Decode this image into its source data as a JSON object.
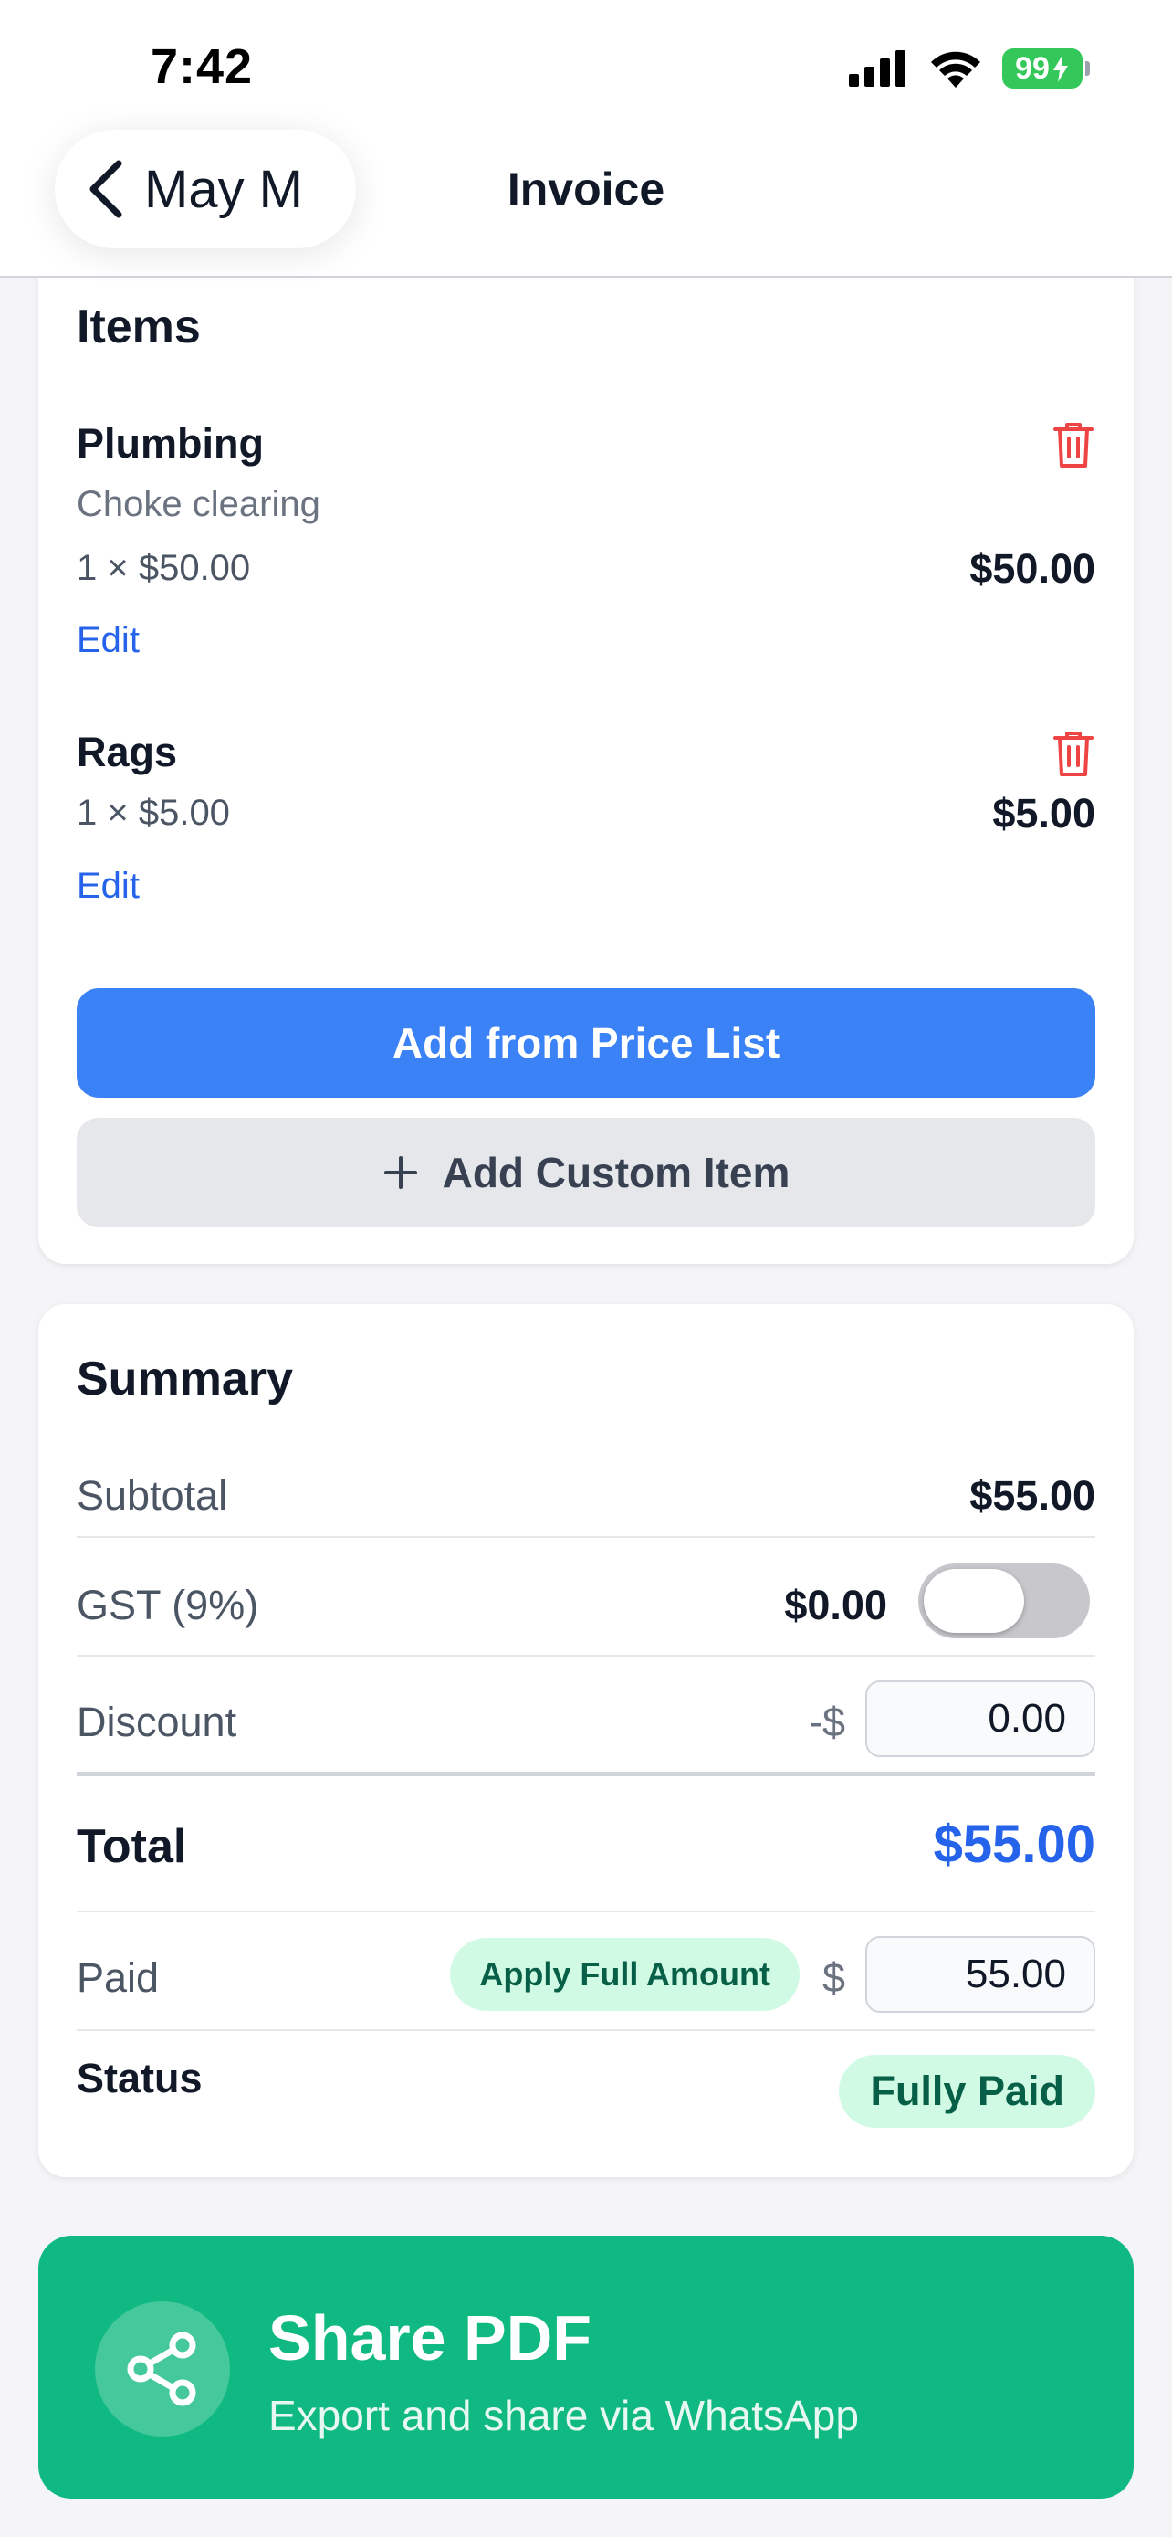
{
  "status_bar": {
    "time": "7:42",
    "battery": "99",
    "icons": [
      "cellular-signal-icon",
      "wifi-icon",
      "battery-icon",
      "charging-bolt-icon"
    ]
  },
  "nav": {
    "back_label": "May M",
    "title": "Invoice"
  },
  "items_section": {
    "heading": "Items",
    "items": [
      {
        "name": "Plumbing",
        "description": "Choke clearing",
        "qty_price": "1 × $50.00",
        "amount": "$50.00",
        "edit_label": "Edit"
      },
      {
        "name": "Rags",
        "qty_price": "1 × $5.00",
        "amount": "$5.00",
        "edit_label": "Edit"
      }
    ],
    "add_price_list_label": "Add from Price List",
    "add_custom_label": "Add Custom Item"
  },
  "summary": {
    "heading": "Summary",
    "subtotal_label": "Subtotal",
    "subtotal_value": "$55.00",
    "gst_label": "GST (9%)",
    "gst_value": "$0.00",
    "gst_enabled": false,
    "discount_label": "Discount",
    "discount_prefix": "-$",
    "discount_value": "0.00",
    "total_label": "Total",
    "total_value": "$55.00",
    "paid_label": "Paid",
    "apply_full_label": "Apply Full Amount",
    "paid_prefix": "$",
    "paid_value": "55.00",
    "status_label": "Status",
    "status_value": "Fully Paid"
  },
  "share": {
    "title": "Share PDF",
    "subtitle": "Export and share via WhatsApp"
  },
  "colors": {
    "primary_blue": "#3b82f6",
    "link_blue": "#2563eb",
    "share_green": "#10b981",
    "delete_red": "#ef4444",
    "paid_badge_bg": "#d1fae5",
    "paid_badge_text": "#065f46"
  }
}
